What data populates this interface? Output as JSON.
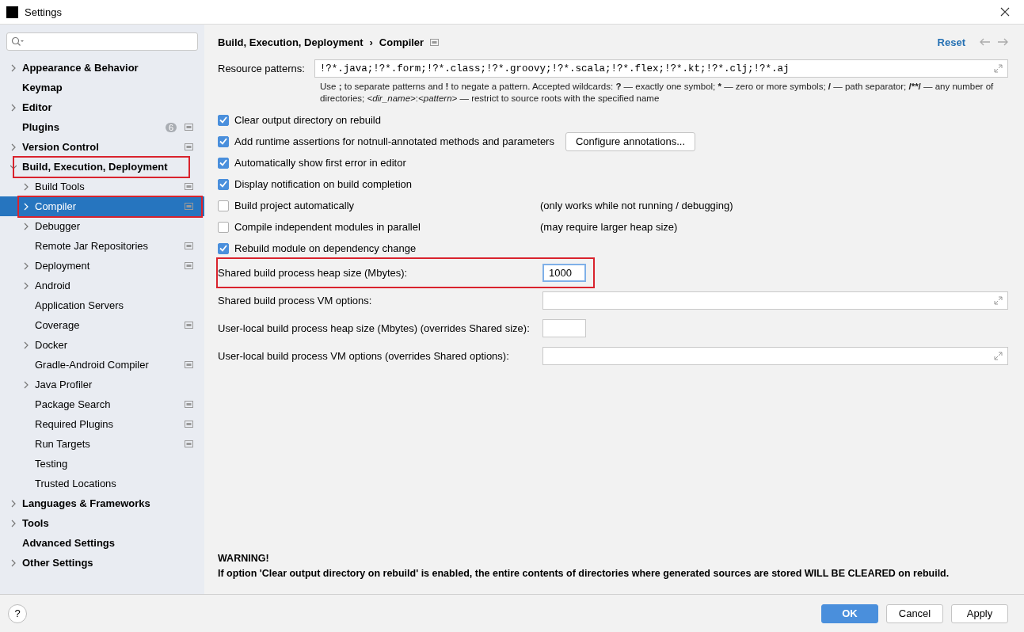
{
  "window": {
    "title": "Settings"
  },
  "sidebar": {
    "items": [
      {
        "label": "Appearance & Behavior",
        "expanded": false,
        "selected": false,
        "highlighted": false,
        "project_scoped": false
      },
      {
        "label": "Keymap",
        "selected": false,
        "highlighted": false,
        "project_scoped": false
      },
      {
        "label": "Editor",
        "expanded": false,
        "selected": false,
        "highlighted": false,
        "project_scoped": false
      },
      {
        "label": "Plugins",
        "selected": false,
        "highlighted": false,
        "project_scoped": true,
        "badge": "6"
      },
      {
        "label": "Version Control",
        "expanded": false,
        "selected": false,
        "highlighted": false,
        "project_scoped": true
      },
      {
        "label": "Build, Execution, Deployment",
        "expanded": true,
        "selected": false,
        "highlighted": true,
        "project_scoped": false,
        "children": [
          {
            "label": "Build Tools",
            "expanded": false,
            "selected": false,
            "highlighted": false,
            "project_scoped": true
          },
          {
            "label": "Compiler",
            "expanded": false,
            "selected": true,
            "highlighted": true,
            "project_scoped": true
          },
          {
            "label": "Debugger",
            "expanded": false,
            "selected": false,
            "highlighted": false,
            "project_scoped": false
          },
          {
            "label": "Remote Jar Repositories",
            "selected": false,
            "highlighted": false,
            "project_scoped": true
          },
          {
            "label": "Deployment",
            "expanded": false,
            "selected": false,
            "highlighted": false,
            "project_scoped": true
          },
          {
            "label": "Android",
            "expanded": false,
            "selected": false,
            "highlighted": false,
            "project_scoped": false
          },
          {
            "label": "Application Servers",
            "selected": false,
            "highlighted": false,
            "project_scoped": false
          },
          {
            "label": "Coverage",
            "selected": false,
            "highlighted": false,
            "project_scoped": true
          },
          {
            "label": "Docker",
            "expanded": false,
            "selected": false,
            "highlighted": false,
            "project_scoped": false
          },
          {
            "label": "Gradle-Android Compiler",
            "selected": false,
            "highlighted": false,
            "project_scoped": true
          },
          {
            "label": "Java Profiler",
            "expanded": false,
            "selected": false,
            "highlighted": false,
            "project_scoped": false
          },
          {
            "label": "Package Search",
            "selected": false,
            "highlighted": false,
            "project_scoped": true
          },
          {
            "label": "Required Plugins",
            "selected": false,
            "highlighted": false,
            "project_scoped": true
          },
          {
            "label": "Run Targets",
            "selected": false,
            "highlighted": false,
            "project_scoped": true
          },
          {
            "label": "Testing",
            "selected": false,
            "highlighted": false,
            "project_scoped": false
          },
          {
            "label": "Trusted Locations",
            "selected": false,
            "highlighted": false,
            "project_scoped": false
          }
        ]
      },
      {
        "label": "Languages & Frameworks",
        "expanded": false,
        "selected": false,
        "highlighted": false,
        "project_scoped": false
      },
      {
        "label": "Tools",
        "expanded": false,
        "selected": false,
        "highlighted": false,
        "project_scoped": false
      },
      {
        "label": "Advanced Settings",
        "selected": false,
        "highlighted": false,
        "project_scoped": false
      },
      {
        "label": "Other Settings",
        "expanded": false,
        "selected": false,
        "highlighted": false,
        "project_scoped": false
      }
    ]
  },
  "header": {
    "breadcrumbs": [
      "Build, Execution, Deployment",
      "Compiler"
    ],
    "separator": "›",
    "reset": "Reset"
  },
  "resource_patterns": {
    "label": "Resource patterns:",
    "value": "!?*.java;!?*.form;!?*.class;!?*.groovy;!?*.scala;!?*.flex;!?*.kt;!?*.clj;!?*.aj",
    "hint": [
      {
        "text": "Use ",
        "kind": "plain"
      },
      {
        "text": ";",
        "kind": "bold"
      },
      {
        "text": " to separate patterns and ",
        "kind": "plain"
      },
      {
        "text": "!",
        "kind": "bold"
      },
      {
        "text": " to negate a pattern. Accepted wildcards: ",
        "kind": "plain"
      },
      {
        "text": "?",
        "kind": "bold"
      },
      {
        "text": " — exactly one symbol; ",
        "kind": "plain"
      },
      {
        "text": "*",
        "kind": "bold"
      },
      {
        "text": " — zero or more symbols; ",
        "kind": "plain"
      },
      {
        "text": "/",
        "kind": "bold"
      },
      {
        "text": " — path separator; ",
        "kind": "plain"
      },
      {
        "text": "/**/",
        "kind": "bold"
      },
      {
        "text": " — any number of directories; ",
        "kind": "plain"
      },
      {
        "text": "<dir_name>",
        "kind": "italic"
      },
      {
        "text": ":",
        "kind": "plain"
      },
      {
        "text": "<pattern>",
        "kind": "italic"
      },
      {
        "text": " — restrict to source roots with the specified name",
        "kind": "plain"
      }
    ]
  },
  "options": [
    {
      "label": "Clear output directory on rebuild",
      "checked": true
    },
    {
      "label": "Add runtime assertions for notnull-annotated methods and parameters",
      "checked": true,
      "button": "Configure annotations..."
    },
    {
      "label": "Automatically show first error in editor",
      "checked": true
    },
    {
      "label": "Display notification on build completion",
      "checked": true
    },
    {
      "label": "Build project automatically",
      "checked": false,
      "note": "(only works while not running / debugging)"
    },
    {
      "label": "Compile independent modules in parallel",
      "checked": false,
      "note": "(may require larger heap size)"
    },
    {
      "label": "Rebuild module on dependency change",
      "checked": true
    }
  ],
  "fields": [
    {
      "label": "Shared build process heap size (Mbytes):",
      "value": "1000",
      "kind": "short",
      "highlighted": true
    },
    {
      "label": "Shared build process VM options:",
      "kind": "long",
      "highlighted": false
    },
    {
      "label": "User-local build process heap size (Mbytes) (overrides Shared size):",
      "kind": "short",
      "highlighted": false
    },
    {
      "label": "User-local build process VM options (overrides Shared options):",
      "kind": "long",
      "highlighted": false
    }
  ],
  "warning": {
    "title": "WARNING!",
    "text": "If option 'Clear output directory on rebuild' is enabled, the entire contents of directories where generated sources are stored WILL BE CLEARED on rebuild."
  },
  "buttons": [
    {
      "label": "OK",
      "kind": "primary"
    },
    {
      "label": "Cancel",
      "kind": "normal"
    },
    {
      "label": "Apply",
      "kind": "normal"
    }
  ],
  "help": "?"
}
